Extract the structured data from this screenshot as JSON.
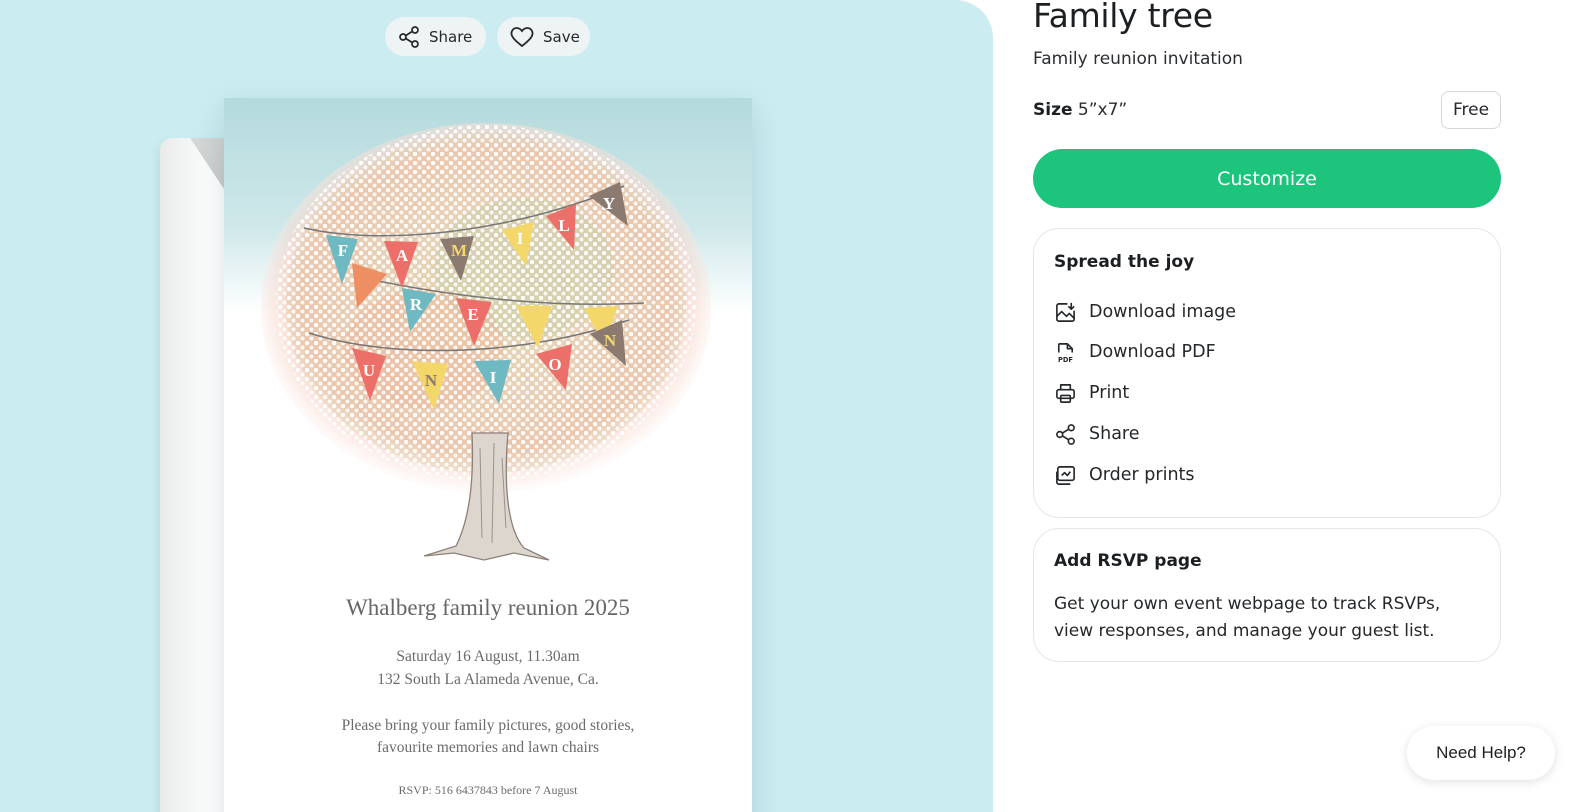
{
  "preview": {
    "share_label": "Share",
    "save_label": "Save",
    "card": {
      "banner_top": [
        "F",
        "A",
        "M",
        "I",
        "L",
        "Y"
      ],
      "banner_middle": [
        "R",
        "E",
        "U",
        "N",
        "I",
        "O",
        "N"
      ],
      "title": "Whalberg family reunion 2025",
      "date_line": "Saturday 16 August, 11.30am",
      "address_line": "132 South La Alameda Avenue, Ca.",
      "message_line1": "Please bring your family pictures, good stories,",
      "message_line2": "favourite memories and lawn chairs",
      "rsvp_line": "RSVP: 516 6437843 before 7 August"
    }
  },
  "details": {
    "title": "Family tree",
    "subtitle": "Family reunion invitation",
    "size_label": "Size",
    "size_value": "5”x7”",
    "price_badge": "Free",
    "customize_label": "Customize"
  },
  "spread": {
    "heading": "Spread the joy",
    "actions": [
      {
        "label": "Download image",
        "icon": "download-image-icon"
      },
      {
        "label": "Download PDF",
        "icon": "pdf-icon"
      },
      {
        "label": "Print",
        "icon": "printer-icon"
      },
      {
        "label": "Share",
        "icon": "share-icon"
      },
      {
        "label": "Order prints",
        "icon": "order-prints-icon"
      }
    ]
  },
  "rsvp": {
    "heading": "Add RSVP page",
    "description": "Get your own event webpage to track RSVPs, view responses, and manage your guest list."
  },
  "help": {
    "label": "Need Help?"
  },
  "colors": {
    "panel_bg": "#cbedf1",
    "accent_green": "#1dc47c",
    "flag_teal": "#6fb9c2",
    "flag_coral": "#ec6f6a",
    "flag_yellow": "#f4d76a",
    "flag_brown": "#8a7a70",
    "flag_orange": "#ee8e63"
  }
}
